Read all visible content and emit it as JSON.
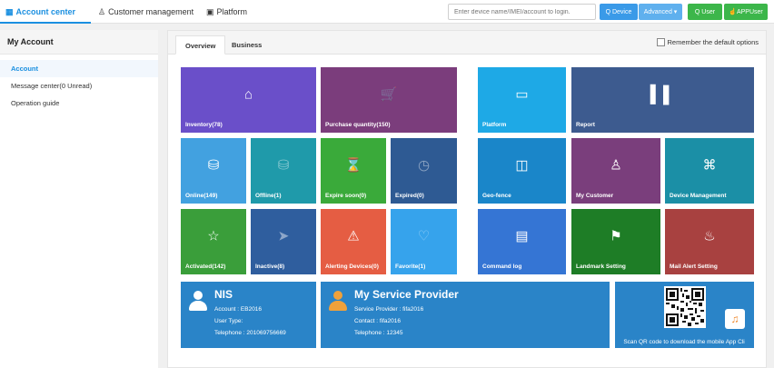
{
  "nav": {
    "account_center": "Account center",
    "customer_management": "Customer management",
    "platform": "Platform"
  },
  "search": {
    "placeholder": "Enter device name/IMEI/account to login.",
    "device_button": "Q Device",
    "advanced_button": "Advanced ▾",
    "user_button": "Q User",
    "appuser_button": "APPUser"
  },
  "sidebar": {
    "title": "My Account",
    "items": [
      {
        "label": "Account",
        "active": true
      },
      {
        "label": "Message center(0 Unread)",
        "active": false
      },
      {
        "label": "Operation guide",
        "active": false
      }
    ]
  },
  "tabs": {
    "overview": "Overview",
    "business": "Business",
    "remember": "Remember the default options"
  },
  "tiles": {
    "inventory": "Inventory(78)",
    "purchase": "Purchase quantity(150)",
    "platform": "Platform",
    "report": "Report",
    "online": "Online(149)",
    "offline": "Offline(1)",
    "expire_soon": "Expire soon(0)",
    "expired": "Expired(0)",
    "geofence": "Geo-fence",
    "my_customer": "My Customer",
    "device_management": "Device Management",
    "activated": "Activated(142)",
    "inactive": "Inactive(8)",
    "alerting": "Alerting Devices(0)",
    "favorite": "Favorite(1)",
    "command_log": "Command log",
    "landmark": "Landmark Setting",
    "mail_alert": "Mail Alert Setting"
  },
  "account_card": {
    "name": "NIS",
    "account_label": "Account : ",
    "account": "EB2016",
    "user_type_label": "User Type:",
    "user_type": "",
    "telephone_label": "Telephone : ",
    "telephone": "201069756669"
  },
  "provider_card": {
    "title": "My Service Provider",
    "provider_label": "Service Provider : ",
    "provider": "fifa2016",
    "contact_label": "Contact : ",
    "contact": "fifa2016",
    "telephone_label": "Telephone : ",
    "telephone": "12345"
  },
  "qr_card": {
    "caption": "Scan QR code to download the mobile App Cli"
  },
  "colors": {
    "accent": "#1a8fe0",
    "purple": "#6a4fc9",
    "plum": "#7b3d7c",
    "sky": "#1ea9e6",
    "slate": "#3d5b8f",
    "green": "#3aaa3a",
    "teal": "#1b8fa6",
    "orange": "#e55d43"
  }
}
